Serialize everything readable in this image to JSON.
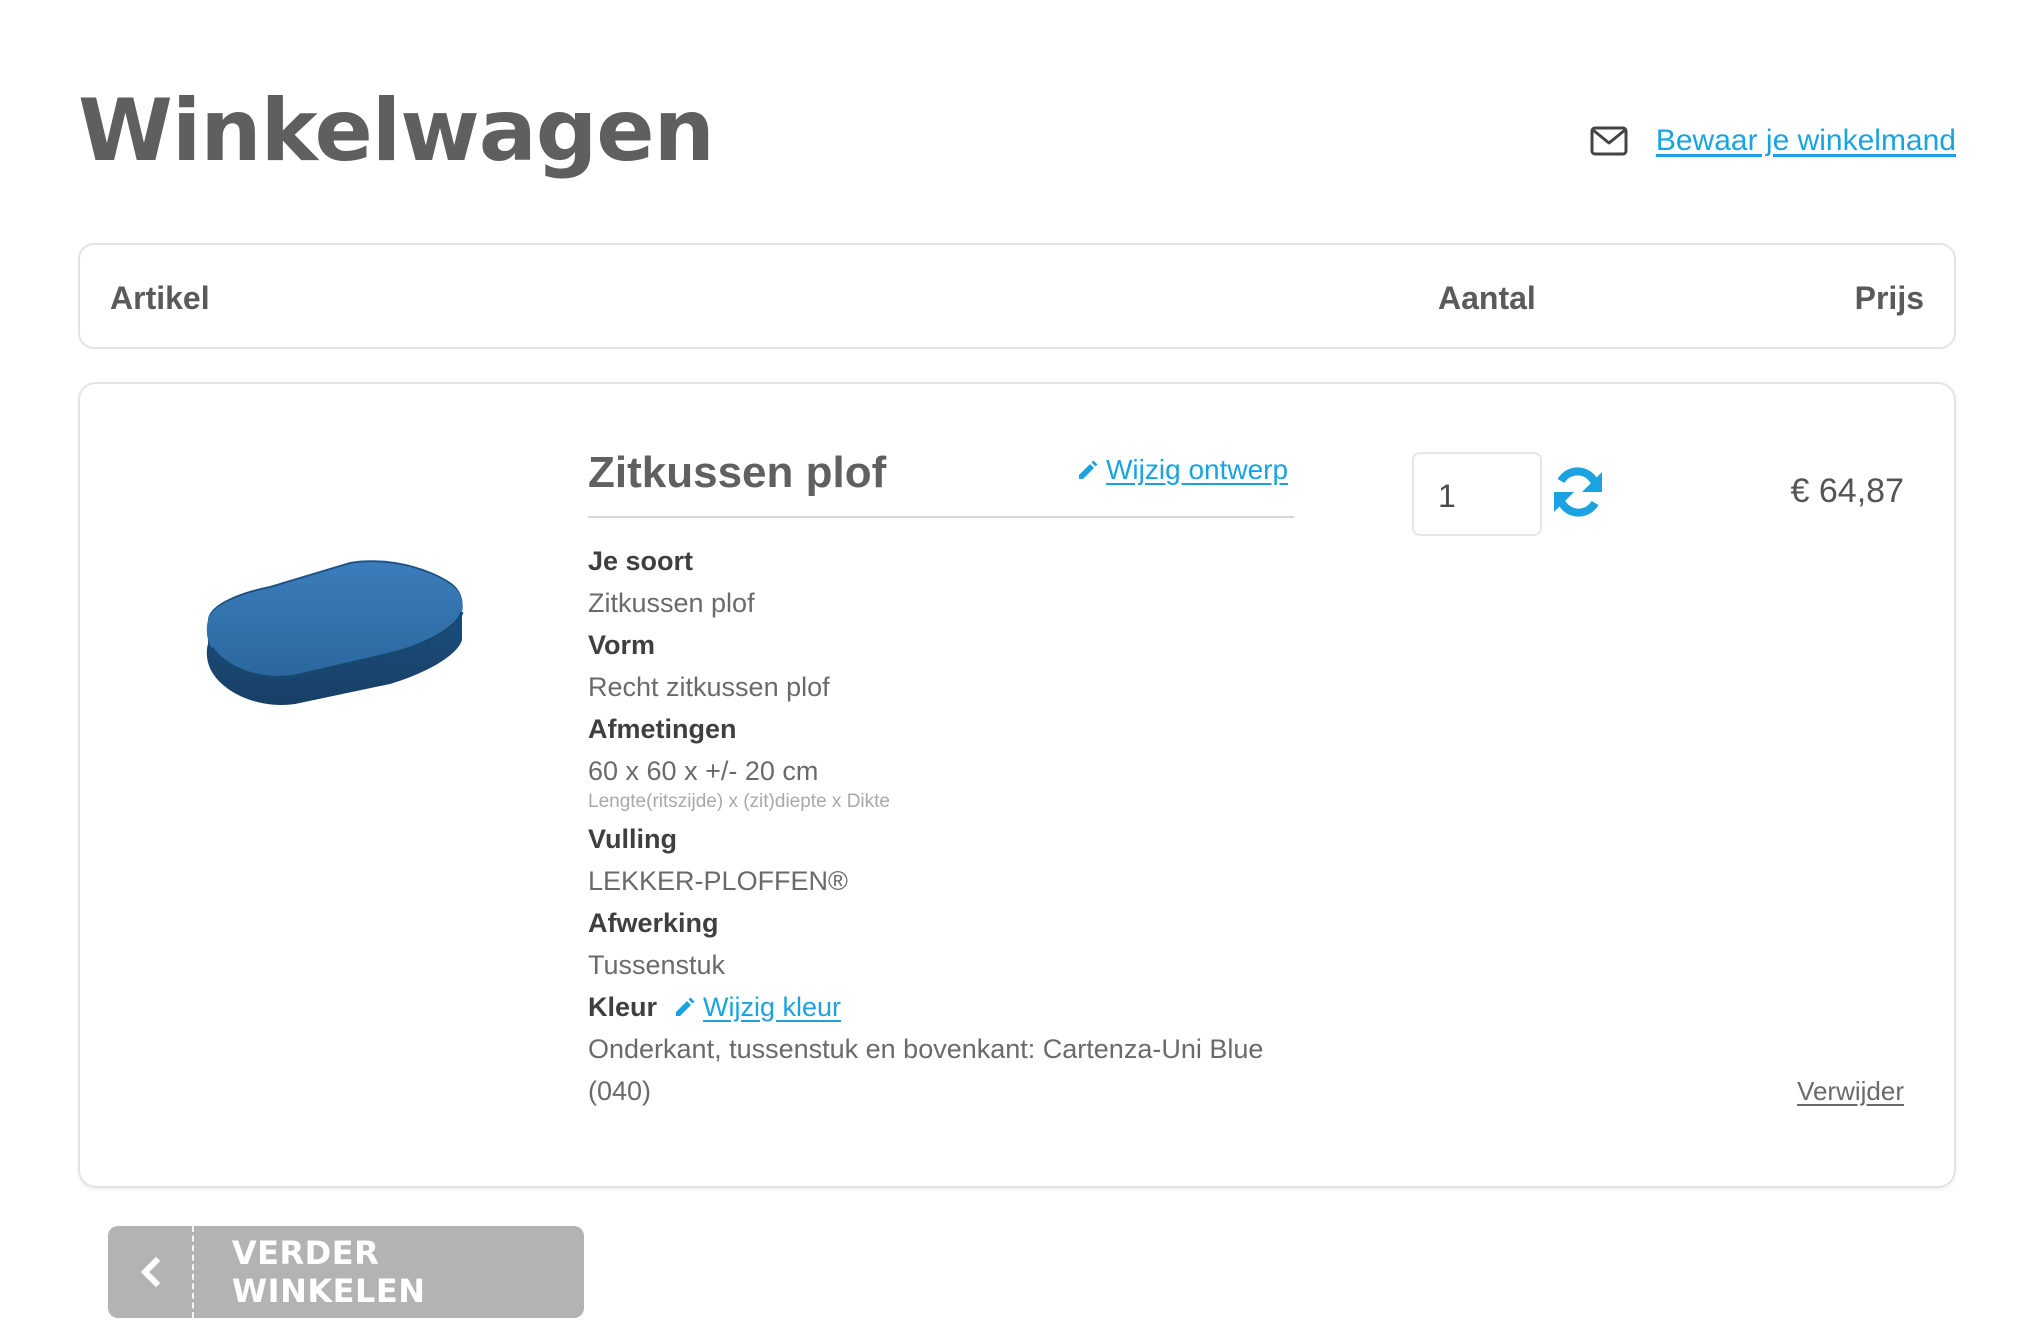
{
  "page": {
    "title": "Winkelwagen",
    "save_cart_link": "Bewaar je winkelmand"
  },
  "table_header": {
    "article": "Artikel",
    "quantity": "Aantal",
    "price": "Prijs"
  },
  "cart_item": {
    "name": "Zitkussen plof",
    "edit_design_label": "Wijzig ontwerp",
    "specs": {
      "soort_label": "Je soort",
      "soort_value": "Zitkussen plof",
      "vorm_label": "Vorm",
      "vorm_value": "Recht zitkussen plof",
      "afmetingen_label": "Afmetingen",
      "afmetingen_value": "60 x 60 x +/- 20 cm",
      "afmetingen_note": "Lengte(ritszijde) x (zit)diepte x Dikte",
      "vulling_label": "Vulling",
      "vulling_value": "LEKKER-PLOFFEN®",
      "afwerking_label": "Afwerking",
      "afwerking_value": "Tussenstuk",
      "kleur_label": "Kleur",
      "edit_color_label": "Wijzig kleur",
      "kleur_value": "Onderkant, tussenstuk en bovenkant: Cartenza-Uni Blue (040)"
    },
    "quantity": "1",
    "price": "€ 64,87",
    "remove_label": "Verwijder",
    "product_color": "#2f6fa8"
  },
  "actions": {
    "continue_shopping": "VERDER WINKELEN"
  },
  "icons": {
    "mail": "mail-icon",
    "pencil": "pencil-icon",
    "refresh": "refresh-icon",
    "chevron": "chevron-left-icon"
  },
  "colors": {
    "accent": "#1aa3e0",
    "button_bg": "#b3b3b3",
    "border": "#e3e3e3"
  }
}
